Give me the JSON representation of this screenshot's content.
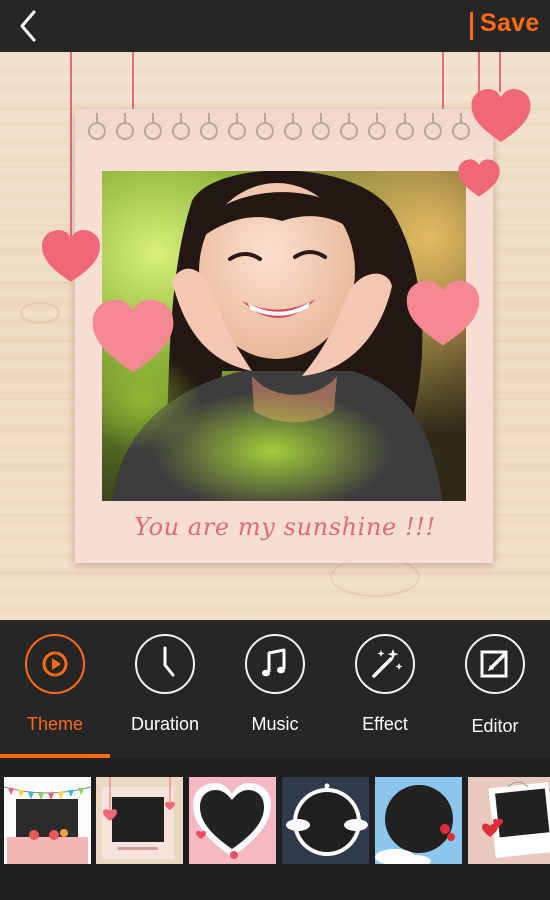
{
  "topbar": {
    "back_icon": "chevron-left-icon",
    "save_label": "Save"
  },
  "preview": {
    "caption": "You are my sunshine !!!"
  },
  "toolbar": {
    "items": [
      {
        "label": "Theme",
        "icon": "play-circle-icon",
        "active": true
      },
      {
        "label": "Duration",
        "icon": "clock-icon",
        "active": false
      },
      {
        "label": "Music",
        "icon": "music-note-icon",
        "active": false
      },
      {
        "label": "Effect",
        "icon": "magic-wand-icon",
        "active": false
      },
      {
        "label": "Editor",
        "icon": "edit-icon",
        "active": false
      }
    ]
  },
  "themes": {
    "items": [
      {
        "name": "theme-bunting"
      },
      {
        "name": "theme-hanging-hearts"
      },
      {
        "name": "theme-pink-heart"
      },
      {
        "name": "theme-night-cloud"
      },
      {
        "name": "theme-blue-sky"
      },
      {
        "name": "theme-polaroid-hearts"
      }
    ]
  },
  "colors": {
    "accent": "#ff6a13",
    "bar_bg": "#262626",
    "heart": "#f06878",
    "caption": "#e06a78"
  }
}
